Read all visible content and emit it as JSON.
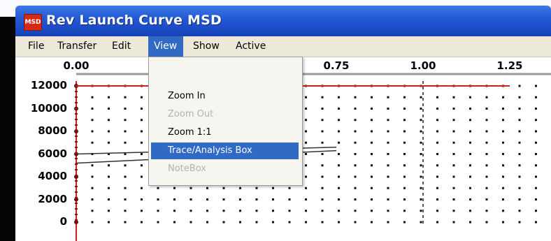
{
  "window": {
    "title": "Rev Launch Curve   MSD",
    "icon": "app-icon",
    "icon_label": "MSD"
  },
  "menu": {
    "items": [
      {
        "label": "File",
        "name": "menu-file"
      },
      {
        "label": "Transfer",
        "name": "menu-transfer"
      },
      {
        "label": "Edit",
        "name": "menu-edit"
      },
      {
        "label": "View",
        "name": "menu-view",
        "active": true
      },
      {
        "label": "Show",
        "name": "menu-show"
      },
      {
        "label": "Active",
        "name": "menu-active"
      }
    ]
  },
  "view_menu": {
    "items": [
      {
        "label": "Zoom In",
        "enabled": true,
        "highlighted": false
      },
      {
        "label": "Zoom Out",
        "enabled": false,
        "highlighted": false
      },
      {
        "label": "Zoom 1:1",
        "enabled": true,
        "highlighted": false
      },
      {
        "label": "Trace/Analysis Box",
        "enabled": true,
        "highlighted": true
      },
      {
        "label": "NoteBox",
        "enabled": false,
        "highlighted": false
      }
    ]
  },
  "chart_data": {
    "type": "line",
    "x_tick_labels": [
      "0.00",
      "0.75",
      "1.00",
      "1.25"
    ],
    "y_tick_labels": [
      "12000",
      "10000",
      "8000",
      "6000",
      "4000",
      "2000",
      "0"
    ],
    "x": [
      0.0,
      0.75,
      1.0,
      1.25
    ],
    "y_ticks": [
      12000,
      10000,
      8000,
      6000,
      4000,
      2000,
      0
    ],
    "ylim": [
      0,
      12000
    ],
    "grid": true,
    "series": [
      {
        "values": [
          12000,
          12000,
          12000,
          12000
        ],
        "color": "#cc2222"
      },
      {
        "values": [
          6000,
          6600
        ],
        "color": "#333333"
      },
      {
        "values": [
          5200,
          6300
        ],
        "color": "#333333"
      }
    ],
    "colors": {
      "axis": "#cc2222",
      "grid": "#111111"
    }
  }
}
